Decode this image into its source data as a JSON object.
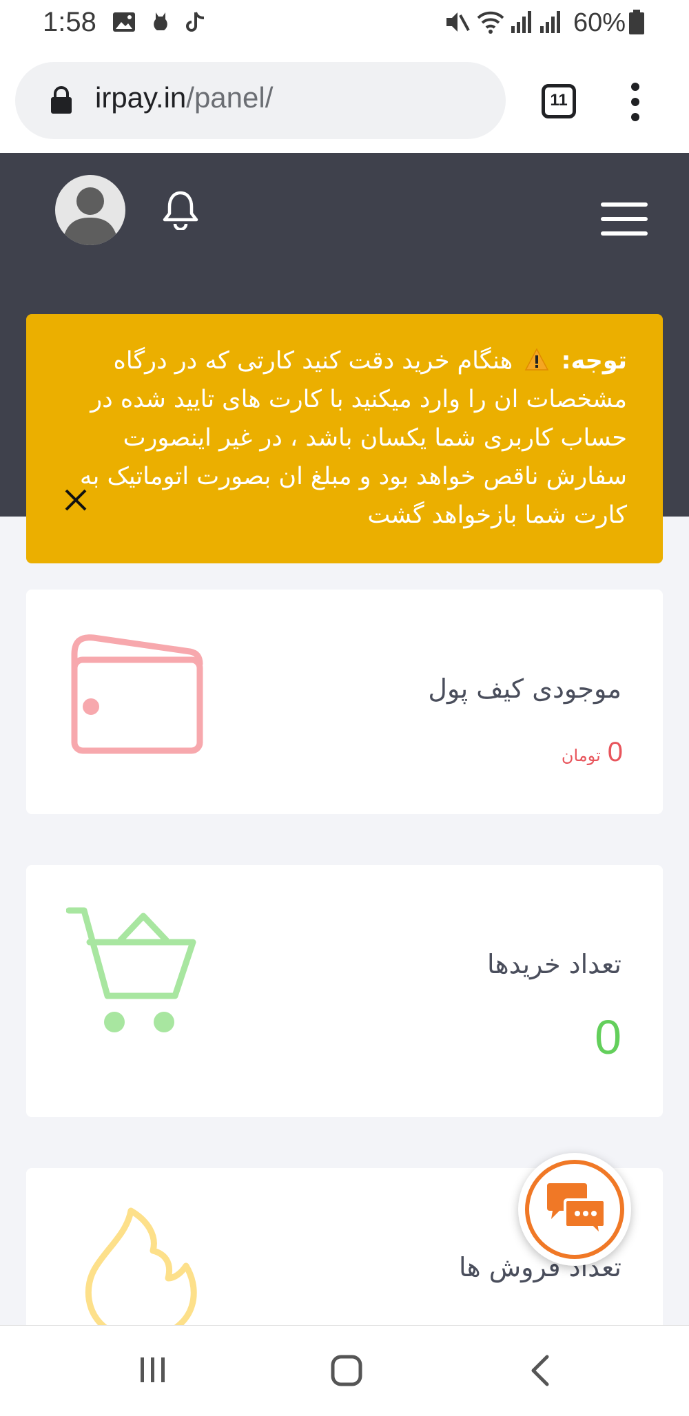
{
  "status_bar": {
    "time": "1:58",
    "battery": "60%",
    "icons": [
      "image-icon",
      "cat-notification-icon",
      "tiktok-icon",
      "mute-icon",
      "wifi-icon",
      "signal-icon",
      "signal-icon",
      "battery-icon"
    ]
  },
  "browser": {
    "url_host": "irpay.in",
    "url_path": "/panel/",
    "tab_count": "11"
  },
  "alert": {
    "label": "توجه:",
    "message": "هنگام خرید دقت کنید کارتی که در درگاه مشخصات ان را وارد میکنید با کارت های تایید شده در حساب کاربری شما یکسان باشد ، در غیر اینصورت سفارش ناقص خواهد بود و مبلغ ان بصورت اتوماتیک به کارت شما بازخواهد گشت",
    "color": "#ebaf00"
  },
  "cards": {
    "wallet": {
      "title": "موجودی کیف پول",
      "value": "0",
      "unit": "تومان",
      "icon": "wallet-icon",
      "color": "#f7a8ad"
    },
    "purchases": {
      "title": "تعداد خریدها",
      "value": "0",
      "icon": "cart-icon",
      "color": "#a8e6a0"
    },
    "sales": {
      "title": "تعداد فروش ها",
      "icon": "fire-icon",
      "color": "#fde08a"
    }
  },
  "colors": {
    "header": "#3f414c",
    "accent_orange": "#f07826"
  }
}
